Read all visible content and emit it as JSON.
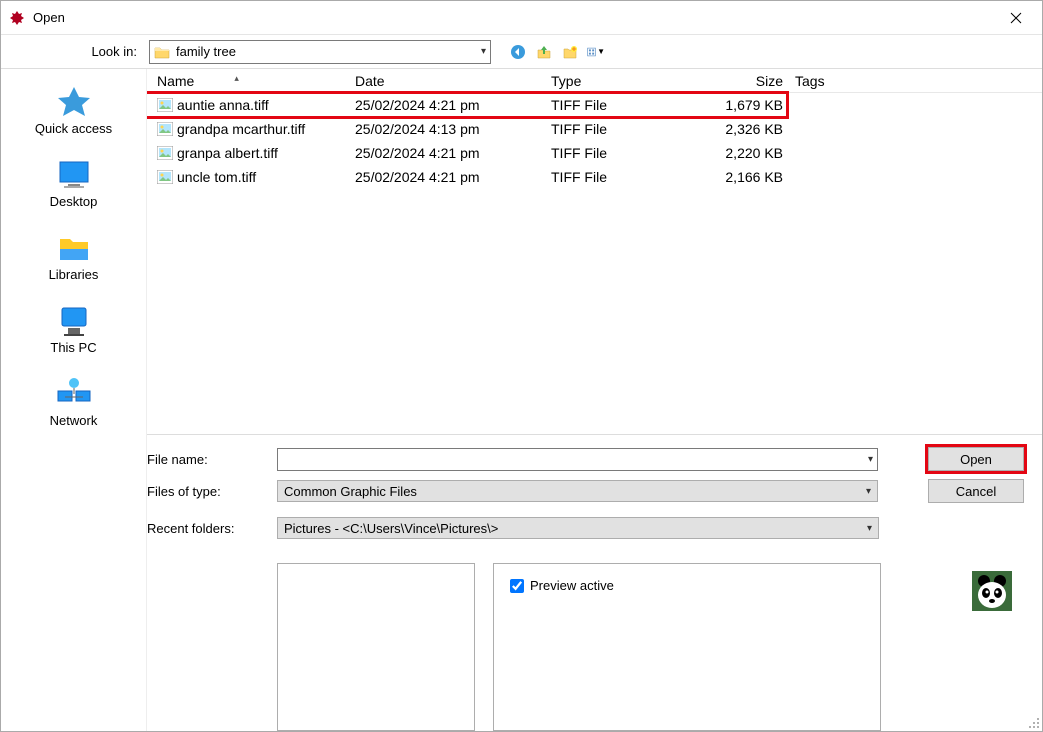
{
  "window": {
    "title": "Open"
  },
  "toolbar": {
    "lookin_label": "Look in:",
    "current_folder": "family tree",
    "icons": {
      "back": "back-icon",
      "up": "up-icon",
      "newfolder": "newfolder-icon",
      "view": "view-icon"
    }
  },
  "sidebar": {
    "items": [
      {
        "label": "Quick access"
      },
      {
        "label": "Desktop"
      },
      {
        "label": "Libraries"
      },
      {
        "label": "This PC"
      },
      {
        "label": "Network"
      }
    ]
  },
  "columns": {
    "name": "Name",
    "date": "Date",
    "type": "Type",
    "size": "Size",
    "tags": "Tags"
  },
  "files": [
    {
      "name": "auntie anna.tiff",
      "date": "25/02/2024 4:21 pm",
      "type": "TIFF File",
      "size": "1,679 KB"
    },
    {
      "name": "grandpa mcarthur.tiff",
      "date": "25/02/2024 4:13 pm",
      "type": "TIFF File",
      "size": "2,326 KB"
    },
    {
      "name": "granpa albert.tiff",
      "date": "25/02/2024 4:21 pm",
      "type": "TIFF File",
      "size": "2,220 KB"
    },
    {
      "name": "uncle tom.tiff",
      "date": "25/02/2024 4:21 pm",
      "type": "TIFF File",
      "size": "2,166 KB"
    }
  ],
  "form": {
    "filename_label": "File name:",
    "filename_value": "",
    "filetype_label": "Files of type:",
    "filetype_value": "Common Graphic Files",
    "recent_label": "Recent folders:",
    "recent_value": "Pictures  -  <C:\\Users\\Vince\\Pictures\\>",
    "open_label": "Open",
    "cancel_label": "Cancel"
  },
  "preview": {
    "checkbox_label": "Preview active",
    "checked": true
  }
}
